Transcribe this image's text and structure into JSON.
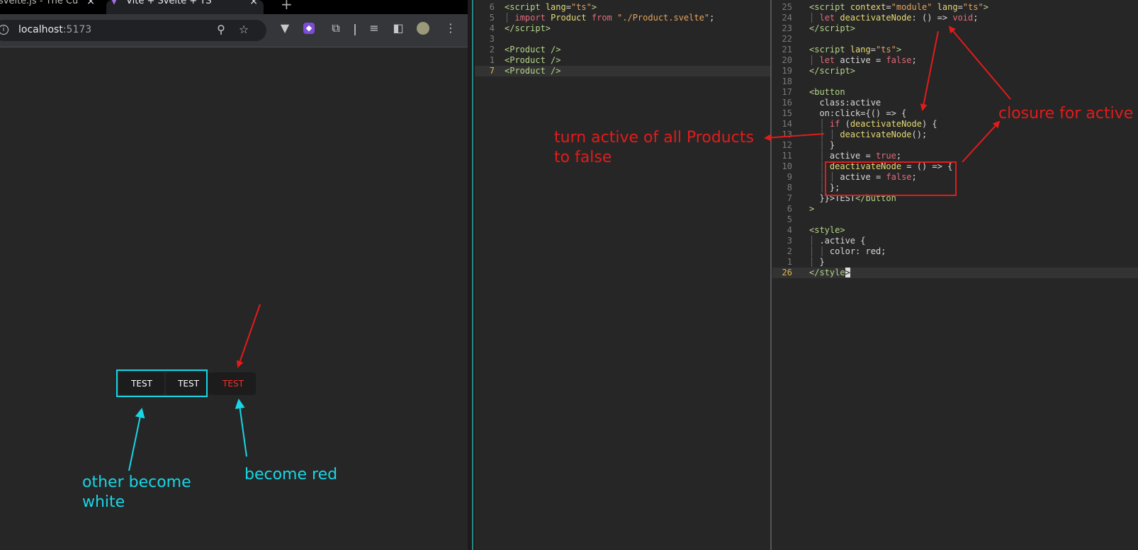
{
  "browser": {
    "tabs": [
      {
        "title": "svelte.js - The Cu",
        "active": false
      },
      {
        "title": "Vite + Svelte + TS",
        "active": true
      }
    ],
    "new_tab": "+",
    "close": "×",
    "url_host": "localhost",
    "url_port": ":5173"
  },
  "page": {
    "buttons": [
      {
        "label": "TEST",
        "active": false
      },
      {
        "label": "TEST",
        "active": false
      },
      {
        "label": "TEST",
        "active": true
      }
    ]
  },
  "annotations": {
    "other_white": [
      "other become",
      "white"
    ],
    "become_red": "become red",
    "turn_active": [
      "turn active of all Products",
      "to false"
    ],
    "closure": "closure for active"
  },
  "editor_left": {
    "lines": [
      {
        "n": "6",
        "html": "<span class=\"tag\">&lt;script</span> <span class=\"attr\">lang</span>=<span class=\"str\">\"ts\"</span><span class=\"tag\">&gt;</span>"
      },
      {
        "n": "5",
        "html": "<span class=\"guide\">│</span> <span class=\"kw\">import</span> <span class=\"attr\">Product</span> <span class=\"kw\">from</span> <span class=\"str\">\"./Product.svelte\"</span>;"
      },
      {
        "n": "4",
        "html": "<span class=\"tag\">&lt;/script&gt;</span>"
      },
      {
        "n": "3",
        "html": ""
      },
      {
        "n": "2",
        "html": "<span class=\"tag\">&lt;Product</span> <span class=\"tag\">/&gt;</span>"
      },
      {
        "n": "1",
        "html": "<span class=\"tag\">&lt;Product</span> <span class=\"tag\">/&gt;</span>"
      },
      {
        "n": "7",
        "html": "<span class=\"tag\">&lt;Product</span> <span class=\"tag\">/&gt;</span>",
        "current": true
      }
    ]
  },
  "editor_right": {
    "lines": [
      {
        "n": "25",
        "html": "<span class=\"tag\">&lt;script</span> <span class=\"attr\">context</span>=<span class=\"str\">\"module\"</span> <span class=\"attr\">lang</span>=<span class=\"str\">\"ts\"</span><span class=\"tag\">&gt;</span>"
      },
      {
        "n": "24",
        "html": "<span class=\"guide\">│</span> <span class=\"kw\">let</span> <span class=\"fn\">deactivateNode</span>: () =&gt; <span class=\"kw\">void</span>;"
      },
      {
        "n": "23",
        "html": "<span class=\"tag\">&lt;/script&gt;</span>"
      },
      {
        "n": "22",
        "html": ""
      },
      {
        "n": "21",
        "html": "<span class=\"tag\">&lt;script</span> <span class=\"attr\">lang</span>=<span class=\"str\">\"ts\"</span><span class=\"tag\">&gt;</span>"
      },
      {
        "n": "20",
        "html": "<span class=\"guide\">│</span> <span class=\"kw\">let</span> active = <span class=\"bool\">false</span>;"
      },
      {
        "n": "19",
        "html": "<span class=\"tag\">&lt;/script&gt;</span>"
      },
      {
        "n": "18",
        "html": ""
      },
      {
        "n": "17",
        "html": "<span class=\"tag\">&lt;button</span>"
      },
      {
        "n": "16",
        "html": "  class:active"
      },
      {
        "n": "15",
        "html": "  on:click={() =&gt; {"
      },
      {
        "n": "14",
        "html": "  <span class=\"guide\">│</span> <span class=\"kw\">if</span> (<span class=\"fn\">deactivateNode</span>) {"
      },
      {
        "n": "13",
        "html": "  <span class=\"guide\">│</span> <span class=\"guide\">│</span> <span class=\"fn\">deactivateNode</span>();"
      },
      {
        "n": "12",
        "html": "  <span class=\"guide\">│</span> }"
      },
      {
        "n": "11",
        "html": "  <span class=\"guide\">│</span> active = <span class=\"bool\">true</span>;"
      },
      {
        "n": "10",
        "html": "  <span class=\"guide\">│</span> <span class=\"fn\">deactivateNode</span> = () =&gt; {"
      },
      {
        "n": "9",
        "html": "  <span class=\"guide\">│</span> <span class=\"guide\">│</span> active = <span class=\"bool\">false</span>;"
      },
      {
        "n": "8",
        "html": "  <span class=\"guide\">│</span> };"
      },
      {
        "n": "7",
        "html": "  }}&gt;TEST<span class=\"tag\">&lt;/button</span>"
      },
      {
        "n": "6",
        "html": "<span class=\"tag\">&gt;</span>"
      },
      {
        "n": "5",
        "html": ""
      },
      {
        "n": "4",
        "html": "<span class=\"tag\">&lt;style&gt;</span>"
      },
      {
        "n": "3",
        "html": "<span class=\"guide\">│</span> .active {"
      },
      {
        "n": "2",
        "html": "<span class=\"guide\">│</span> <span class=\"guide\">│</span> color: red;"
      },
      {
        "n": "1",
        "html": "<span class=\"guide\">│</span> }"
      },
      {
        "n": "26",
        "html": "<span class=\"tag\">&lt;/style</span><span style=\"background:#ddd;color:#222\">&gt;</span>",
        "current": true
      }
    ]
  },
  "colors": {
    "annotation_cyan": "#18d6e6",
    "annotation_red": "#e31b1b",
    "active_button_text": "#ff2a2a"
  }
}
